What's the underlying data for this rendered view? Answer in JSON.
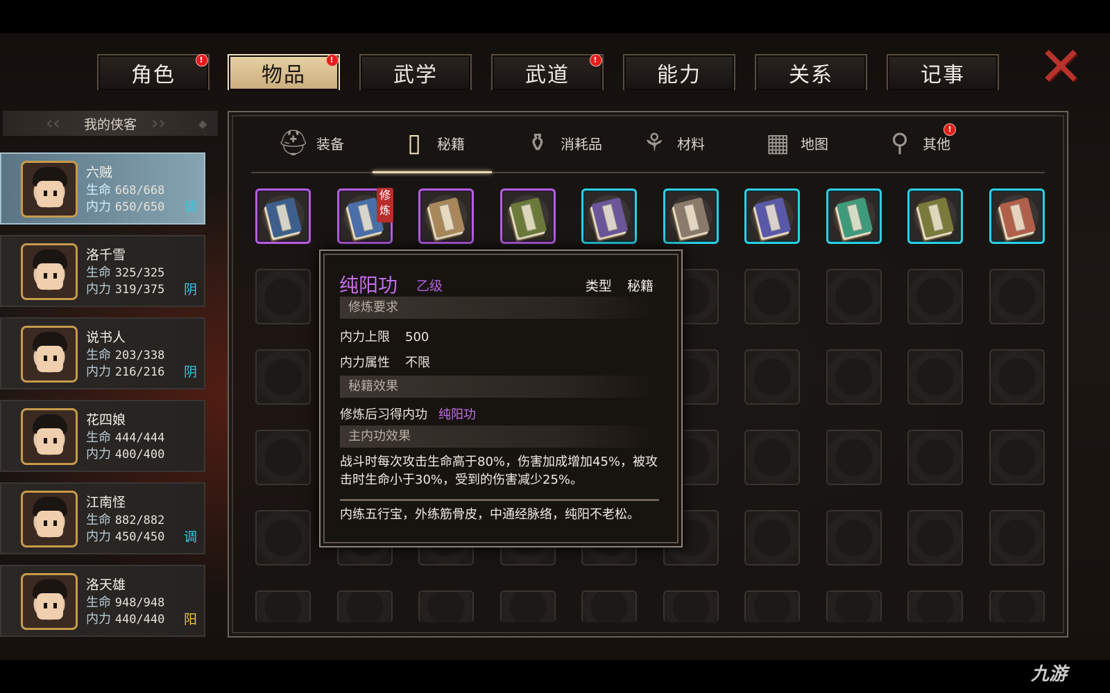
{
  "top_tabs": [
    {
      "label": "角色",
      "badge": "!"
    },
    {
      "label": "物品",
      "badge": "!"
    },
    {
      "label": "武学",
      "badge": ""
    },
    {
      "label": "武道",
      "badge": "!"
    },
    {
      "label": "能力",
      "badge": ""
    },
    {
      "label": "关系",
      "badge": ""
    },
    {
      "label": "记事",
      "badge": ""
    }
  ],
  "close_glyph": "✕",
  "roster": {
    "header": "我的侠客",
    "characters": [
      {
        "name": "六贼",
        "hp_label": "生命",
        "hp": "668/668",
        "mp_label": "内力",
        "mp": "650/650",
        "stance": "调",
        "stance_color": "#37c8e0"
      },
      {
        "name": "洛千雪",
        "hp_label": "生命",
        "hp": "325/325",
        "mp_label": "内力",
        "mp": "319/375",
        "stance": "阴",
        "stance_color": "#37c8e0"
      },
      {
        "name": "说书人",
        "hp_label": "生命",
        "hp": "203/338",
        "mp_label": "内力",
        "mp": "216/216",
        "stance": "阴",
        "stance_color": "#37c8e0"
      },
      {
        "name": "花四娘",
        "hp_label": "生命",
        "hp": "444/444",
        "mp_label": "内力",
        "mp": "400/400",
        "stance": "",
        "stance_color": "#37c8e0"
      },
      {
        "name": "江南怪",
        "hp_label": "生命",
        "hp": "882/882",
        "mp_label": "内力",
        "mp": "450/450",
        "stance": "调",
        "stance_color": "#37c8e0"
      },
      {
        "name": "洛天雄",
        "hp_label": "生命",
        "hp": "948/948",
        "mp_label": "内力",
        "mp": "440/440",
        "stance": "阳",
        "stance_color": "#e8c640"
      }
    ]
  },
  "sub_tabs": [
    {
      "label": "装备",
      "icon": "helmet-icon",
      "badge": ""
    },
    {
      "label": "秘籍",
      "icon": "book-icon",
      "badge": ""
    },
    {
      "label": "消耗品",
      "icon": "potion-icon",
      "badge": ""
    },
    {
      "label": "材料",
      "icon": "herb-icon",
      "badge": ""
    },
    {
      "label": "地图",
      "icon": "map-icon",
      "badge": ""
    },
    {
      "label": "其他",
      "icon": "pendant-icon",
      "badge": "!"
    }
  ],
  "items": [
    {
      "rarity": "purple",
      "cover": "#3e5f8c",
      "practice": ""
    },
    {
      "rarity": "purple",
      "cover": "#4a6fa8",
      "practice": "修炼"
    },
    {
      "rarity": "purple",
      "cover": "#a8875a",
      "practice": ""
    },
    {
      "rarity": "purple",
      "cover": "#6b7a3a",
      "practice": ""
    },
    {
      "rarity": "cyan",
      "cover": "#6a5698",
      "practice": ""
    },
    {
      "rarity": "cyan",
      "cover": "#8a7a6a",
      "practice": ""
    },
    {
      "rarity": "cyan",
      "cover": "#5a58a8",
      "practice": ""
    },
    {
      "rarity": "cyan",
      "cover": "#3f9a7c",
      "practice": ""
    },
    {
      "rarity": "cyan",
      "cover": "#7a7a3a",
      "practice": ""
    },
    {
      "rarity": "cyan",
      "cover": "#b0604a",
      "practice": ""
    }
  ],
  "tooltip": {
    "title": "纯阳功",
    "grade": "乙级",
    "type_label": "类型",
    "type_value": "秘籍",
    "req_header": "修炼要求",
    "req_rows": [
      {
        "label": "内力上限",
        "value": "500"
      },
      {
        "label": "内力属性",
        "value": "不限"
      }
    ],
    "effect_header": "秘籍效果",
    "effect_label": "修炼后习得内功",
    "effect_value": "纯阳功",
    "main_header": "主内功效果",
    "main_text": "战斗时每次攻击生命高于80%，伤害加成增加45%，被攻击时生命小于30%，受到的伤害减少25%。",
    "flavor": "内练五行宝，外练筋骨皮，中通经脉络，纯阳不老松。"
  },
  "watermark": "九游"
}
